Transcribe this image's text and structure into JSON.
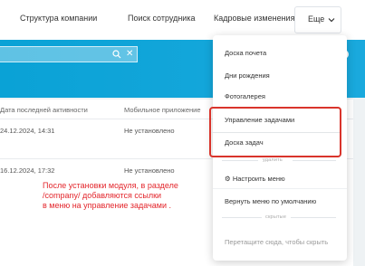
{
  "topnav": {
    "items": [
      "Структура компании",
      "Поиск сотрудника",
      "Кадровые изменения"
    ],
    "more_label": "Еще"
  },
  "table": {
    "columns": [
      "Дата последней активности",
      "Мобильное приложение"
    ],
    "rows": [
      {
        "date": "24.12.2024, 14:31",
        "mobile": "Не установлено"
      },
      {
        "date": "16.12.2024, 17:32",
        "mobile": "Не установлено"
      }
    ]
  },
  "menu": {
    "items": [
      "Доска почета",
      "Дни рождения",
      "Фотогалерея"
    ],
    "highlighted": [
      "Управление задачами",
      "Доска задач"
    ],
    "hidden_section_label": "удалить",
    "configure_label": "Настроить меню",
    "reset_label": "Вернуть меню по умолчанию",
    "drop_section_label": "скрытые",
    "drag_hint": "Перетащите сюда, чтобы скрыть"
  },
  "annotation": {
    "lines": [
      "После установки модуля, в разделе",
      "/company/ добавляются ссылки",
      "в меню на управление задачами ."
    ]
  },
  "colors": {
    "accent": "#14a5da",
    "highlight_border": "#d9342b",
    "note_text": "#e3262c"
  },
  "icons": [
    "search-icon",
    "clear-icon",
    "chevron-down-icon",
    "gear-icon"
  ]
}
